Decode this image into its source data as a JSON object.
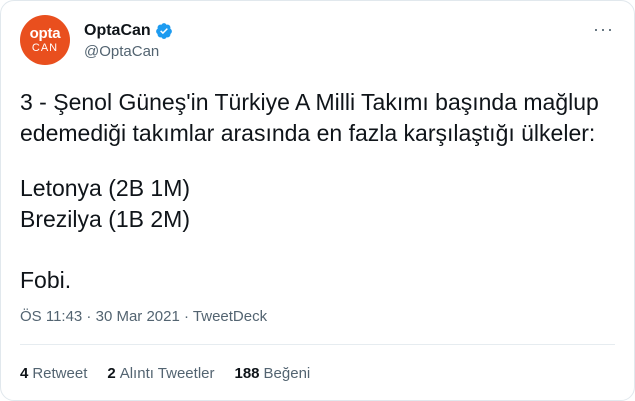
{
  "avatar": {
    "line1": "opta",
    "line2": "CAN",
    "color": "#e94f1e"
  },
  "user": {
    "display_name": "OptaCan",
    "handle": "@OptaCan",
    "verified_color": "#1d9bf0"
  },
  "menu": {
    "label": "···"
  },
  "tweet": {
    "line1": "3 - Şenol Güneş'in Türkiye A Milli Takımı başında mağlup",
    "line2": "edemediği takımlar arasında en fazla karşılaştığı ülkeler:",
    "line3": "Letonya (2B 1M)",
    "line4": "Brezilya (1B 2M)",
    "line5": "Fobi."
  },
  "meta": {
    "time": "ÖS 11:43",
    "separator": " · ",
    "date": "30 Mar 2021",
    "source": "TweetDeck"
  },
  "stats": [
    {
      "count": "4",
      "label": "Retweet"
    },
    {
      "count": "2",
      "label": "Alıntı Tweetler"
    },
    {
      "count": "188",
      "label": "Beğeni"
    }
  ]
}
